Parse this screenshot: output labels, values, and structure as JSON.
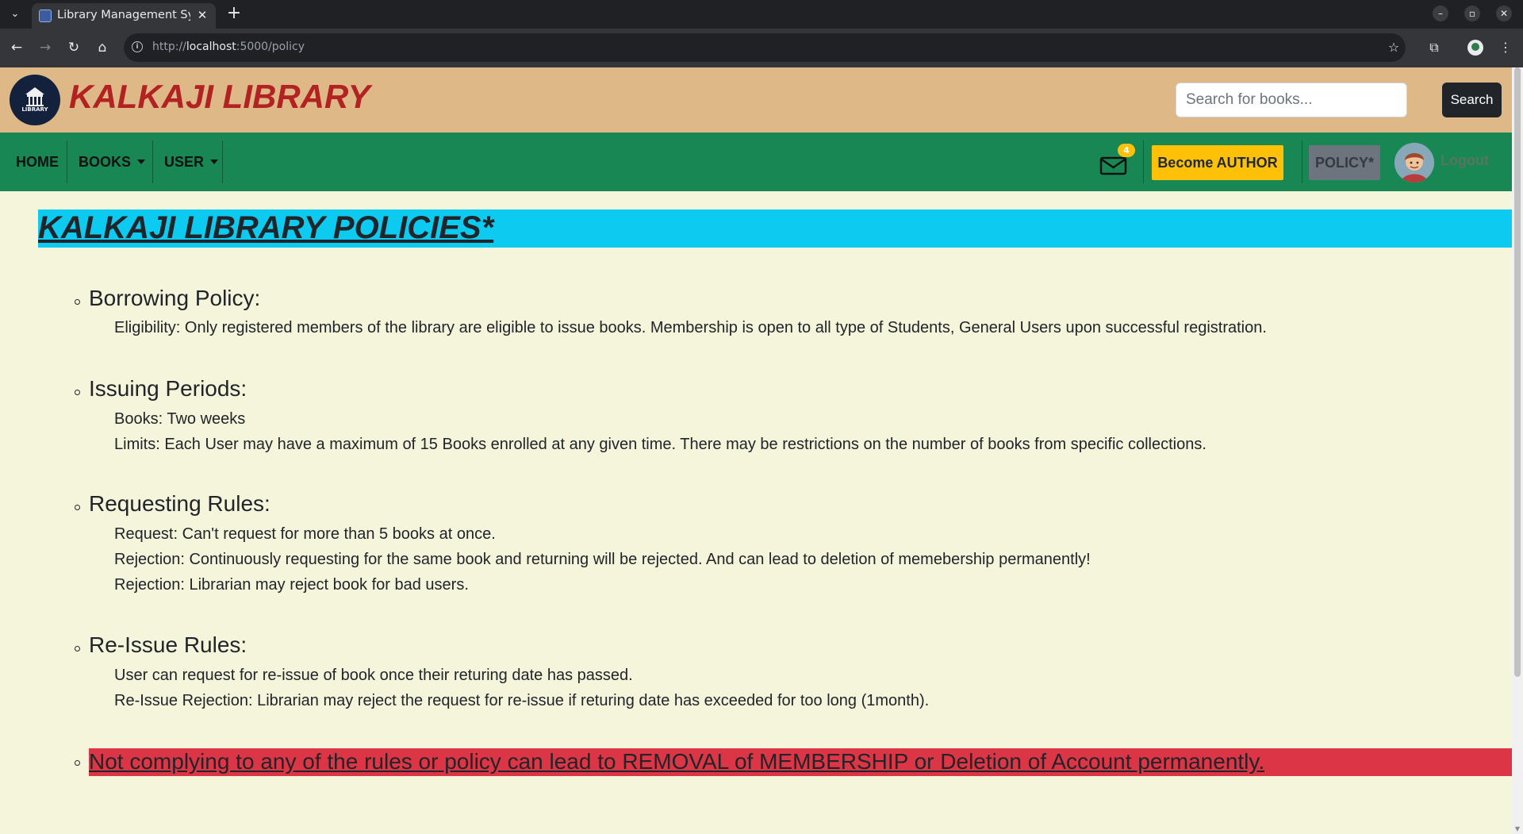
{
  "browser": {
    "tab_title": "Library Management System",
    "url_prefix": "http://",
    "url_host": "localhost",
    "url_path": ":5000/policy",
    "tab_close": "✕",
    "new_tab": "+"
  },
  "site": {
    "brand": "KALKAJI LIBRARY",
    "logo_text": "LIBRARY",
    "search": {
      "placeholder": "Search for books...",
      "button": "Search"
    }
  },
  "nav": {
    "home": "HOME",
    "books": "BOOKS",
    "user": "USER",
    "mail_count": "4",
    "author_button": "Become AUTHOR",
    "policy_button": "POLICY*",
    "logout": "Logout"
  },
  "policy": {
    "title": "KALKAJI LIBRARY POLICIES*",
    "sections": [
      {
        "heading": "Borrowing Policy:",
        "lines": [
          "Eligibility: Only registered members of the library are eligible to issue books. Membership is open to all type of Students, General Users upon successful registration."
        ]
      },
      {
        "heading": "Issuing Periods:",
        "lines": [
          "Books: Two weeks",
          "Limits: Each User may have a maximum of 15 Books enrolled at any given time. There may be restrictions on the number of books from specific collections."
        ]
      },
      {
        "heading": "Requesting Rules:",
        "lines": [
          "Request: Can't request for more than 5 books at once.",
          "Rejection: Continuously requesting for the same book and returning will be rejected. And can lead to deletion of memebership permanently!",
          "Rejection: Librarian may reject book for bad users."
        ]
      },
      {
        "heading": "Re-Issue Rules:",
        "lines": [
          "User can request for re-issue of book once their returing date has passed.",
          "Re-Issue Rejection: Librarian may reject the request for re-issue if returing date has exceeded for too long (1month)."
        ]
      }
    ],
    "warning": "Not complying to any of the rules or policy can lead to REMOVAL of MEMBERSHIP or Deletion of Account permanently."
  },
  "colors": {
    "header": "#deb887",
    "navbar": "#198754",
    "title_band": "#0dcaf0",
    "warning": "#dc3545",
    "page_bg": "#f5f5dc"
  },
  "icons": {
    "tab_menu": "chevron-down-icon",
    "favicon": "favicon-icon",
    "back": "back-arrow-icon",
    "forward": "forward-arrow-icon",
    "reload": "reload-icon",
    "home": "home-icon",
    "site_info": "info-icon",
    "bookmark": "star-icon",
    "extensions": "puzzle-icon",
    "profile": "profile-icon",
    "mail": "envelope-icon",
    "avatar": "avatar-icon"
  }
}
